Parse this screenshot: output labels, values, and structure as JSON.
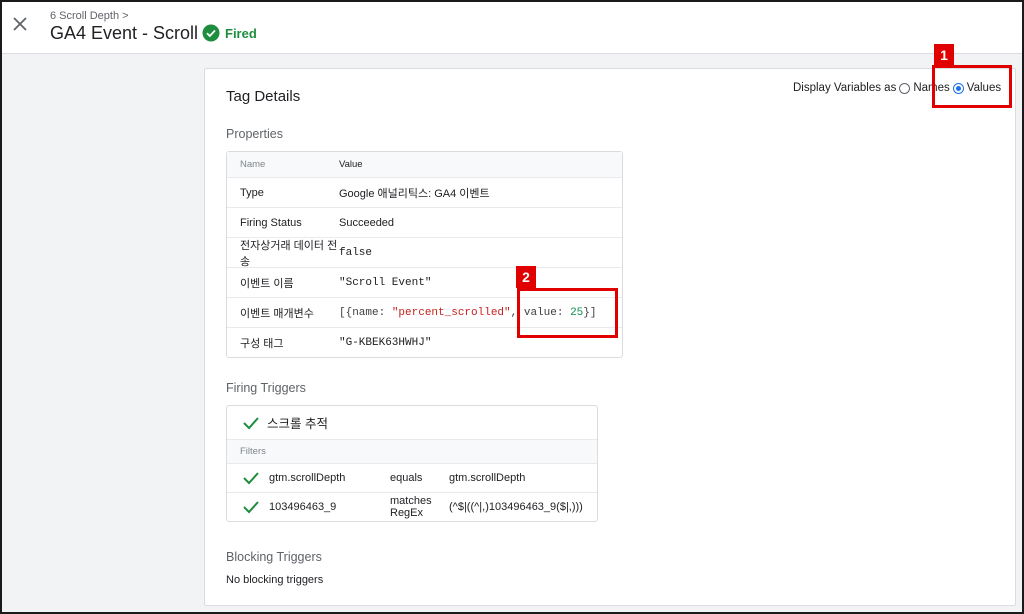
{
  "header": {
    "breadcrumb": "6 Scroll Depth >",
    "title": "GA4 Event - Scroll",
    "status": "Fired",
    "status_color": "#1e8e3e"
  },
  "card": {
    "title": "Tag Details",
    "display_vars": {
      "label": "Display Variables as",
      "options": [
        "Names",
        "Values"
      ],
      "selected": "Values"
    },
    "properties_title": "Properties",
    "properties": {
      "columns": [
        "Name",
        "Value"
      ],
      "rows": [
        {
          "name": "Type",
          "value": "Google 애널리틱스: GA4 이벤트"
        },
        {
          "name": "Firing Status",
          "value": "Succeeded"
        },
        {
          "name": "전자상거래 데이터 전송",
          "value": "false"
        },
        {
          "name": "이벤트 이름",
          "value": "\"Scroll Event\""
        },
        {
          "name": "이벤트 매개변수",
          "value_parts": [
            "[{name: ",
            "\"percent_scrolled\"",
            ", value: ",
            "25",
            "}]"
          ]
        },
        {
          "name": "구성 태그",
          "value": "\"G-KBEK63HWHJ\""
        }
      ]
    },
    "firing_triggers_title": "Firing Triggers",
    "firing_trigger": {
      "name": "스크롤 추적",
      "filters_label": "Filters",
      "filters": [
        {
          "variable": "gtm.scrollDepth",
          "operator": "equals",
          "value": "gtm.scrollDepth"
        },
        {
          "variable": "103496463_9",
          "operator": "matches RegEx",
          "value": "(^$|((^|,)103496463_9($|,)))"
        }
      ]
    },
    "blocking_triggers_title": "Blocking Triggers",
    "blocking_triggers_text": "No blocking triggers"
  },
  "annotations": [
    "1",
    "2"
  ],
  "colors": {
    "accent": "#1a73e8",
    "success": "#1e8e3e",
    "string": "#c5221f",
    "annotation": "#e00000"
  }
}
